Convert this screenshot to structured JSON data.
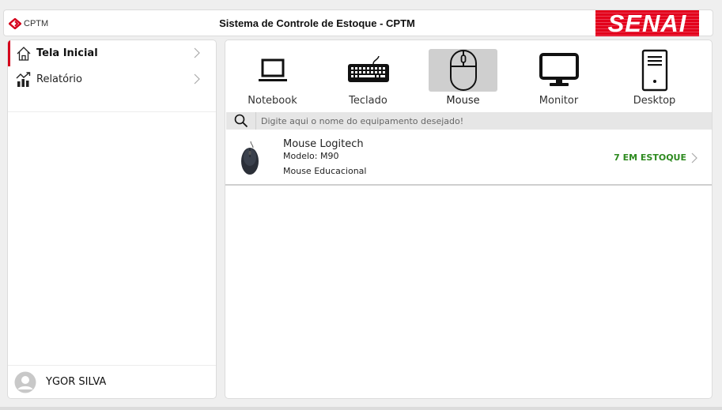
{
  "header": {
    "logo_text": "CPTM",
    "title": "Sistema de Controle de Estoque - CPTM",
    "brand_logo": "SENAI",
    "brand_color": "#e3001b"
  },
  "sidebar": {
    "items": [
      {
        "label": "Tela Inicial",
        "icon": "home-icon",
        "active": true
      },
      {
        "label": "Relatório",
        "icon": "chart-icon",
        "active": false
      }
    ],
    "user": {
      "name": "YGOR SILVA",
      "icon": "avatar-icon"
    },
    "accent": "#d5001c"
  },
  "categories": [
    {
      "label": "Notebook",
      "icon": "notebook-icon",
      "selected": false
    },
    {
      "label": "Teclado",
      "icon": "keyboard-icon",
      "selected": false
    },
    {
      "label": "Mouse",
      "icon": "mouse-icon",
      "selected": true
    },
    {
      "label": "Monitor",
      "icon": "monitor-icon",
      "selected": false
    },
    {
      "label": "Desktop",
      "icon": "desktop-icon",
      "selected": false
    }
  ],
  "search": {
    "placeholder": "Digite aqui o nome do equipamento desejado!",
    "value": ""
  },
  "results": [
    {
      "title": "Mouse Logitech",
      "model": "Modelo: M90",
      "description": "Mouse Educacional",
      "stock": "7 EM ESTOQUE",
      "stock_color": "#2d8a1f"
    }
  ]
}
